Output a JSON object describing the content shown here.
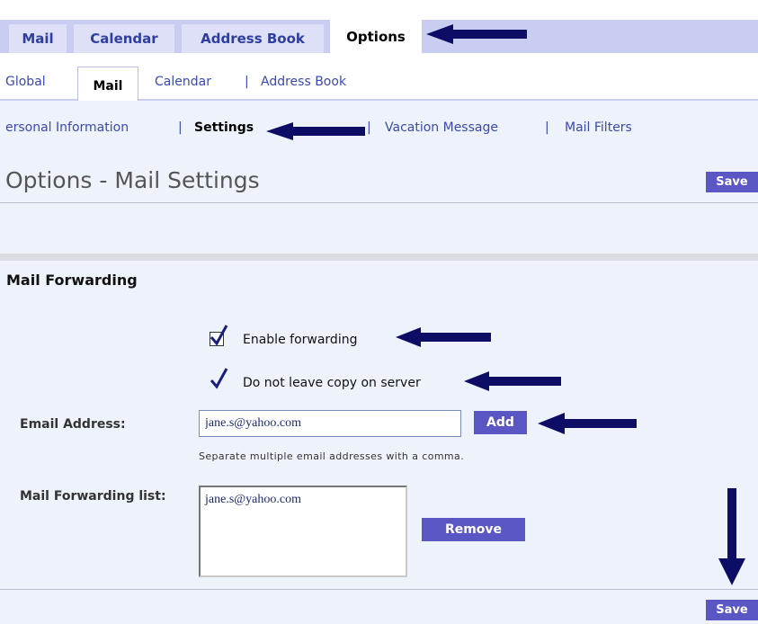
{
  "top_tabs": [
    {
      "label": "Mail"
    },
    {
      "label": "Calendar"
    },
    {
      "label": "Address Book"
    },
    {
      "label": "Options"
    }
  ],
  "sub_tabs": {
    "global": "Global",
    "mail": "Mail",
    "calendar": "Calendar",
    "address_book": "Address Book",
    "separator": "|"
  },
  "settings_nav": {
    "personal": "ersonal Information",
    "settings": "Settings",
    "vacation": "Vacation Message",
    "filters": "Mail Filters",
    "separator": "|"
  },
  "page": {
    "title": "Options - Mail Settings",
    "save_label": "Save"
  },
  "forwarding": {
    "section_title": "Mail Forwarding",
    "enable_label": "Enable forwarding",
    "enable_checked": true,
    "nocopy_label": "Do not leave copy on server",
    "nocopy_checked": true,
    "email_label": "Email Address:",
    "email_value": "jane.s@yahoo.com",
    "add_label": "Add",
    "help_text": "Separate multiple email addresses with a comma.",
    "list_label": "Mail Forwarding list:",
    "list_items": [
      "jane.s@yahoo.com"
    ],
    "remove_label": "Remove"
  },
  "colors": {
    "tab_strip": "#c9cdf2",
    "tab_text": "#2f3ea1",
    "button": "#5a57c4",
    "arrow": "#0d0d66"
  }
}
